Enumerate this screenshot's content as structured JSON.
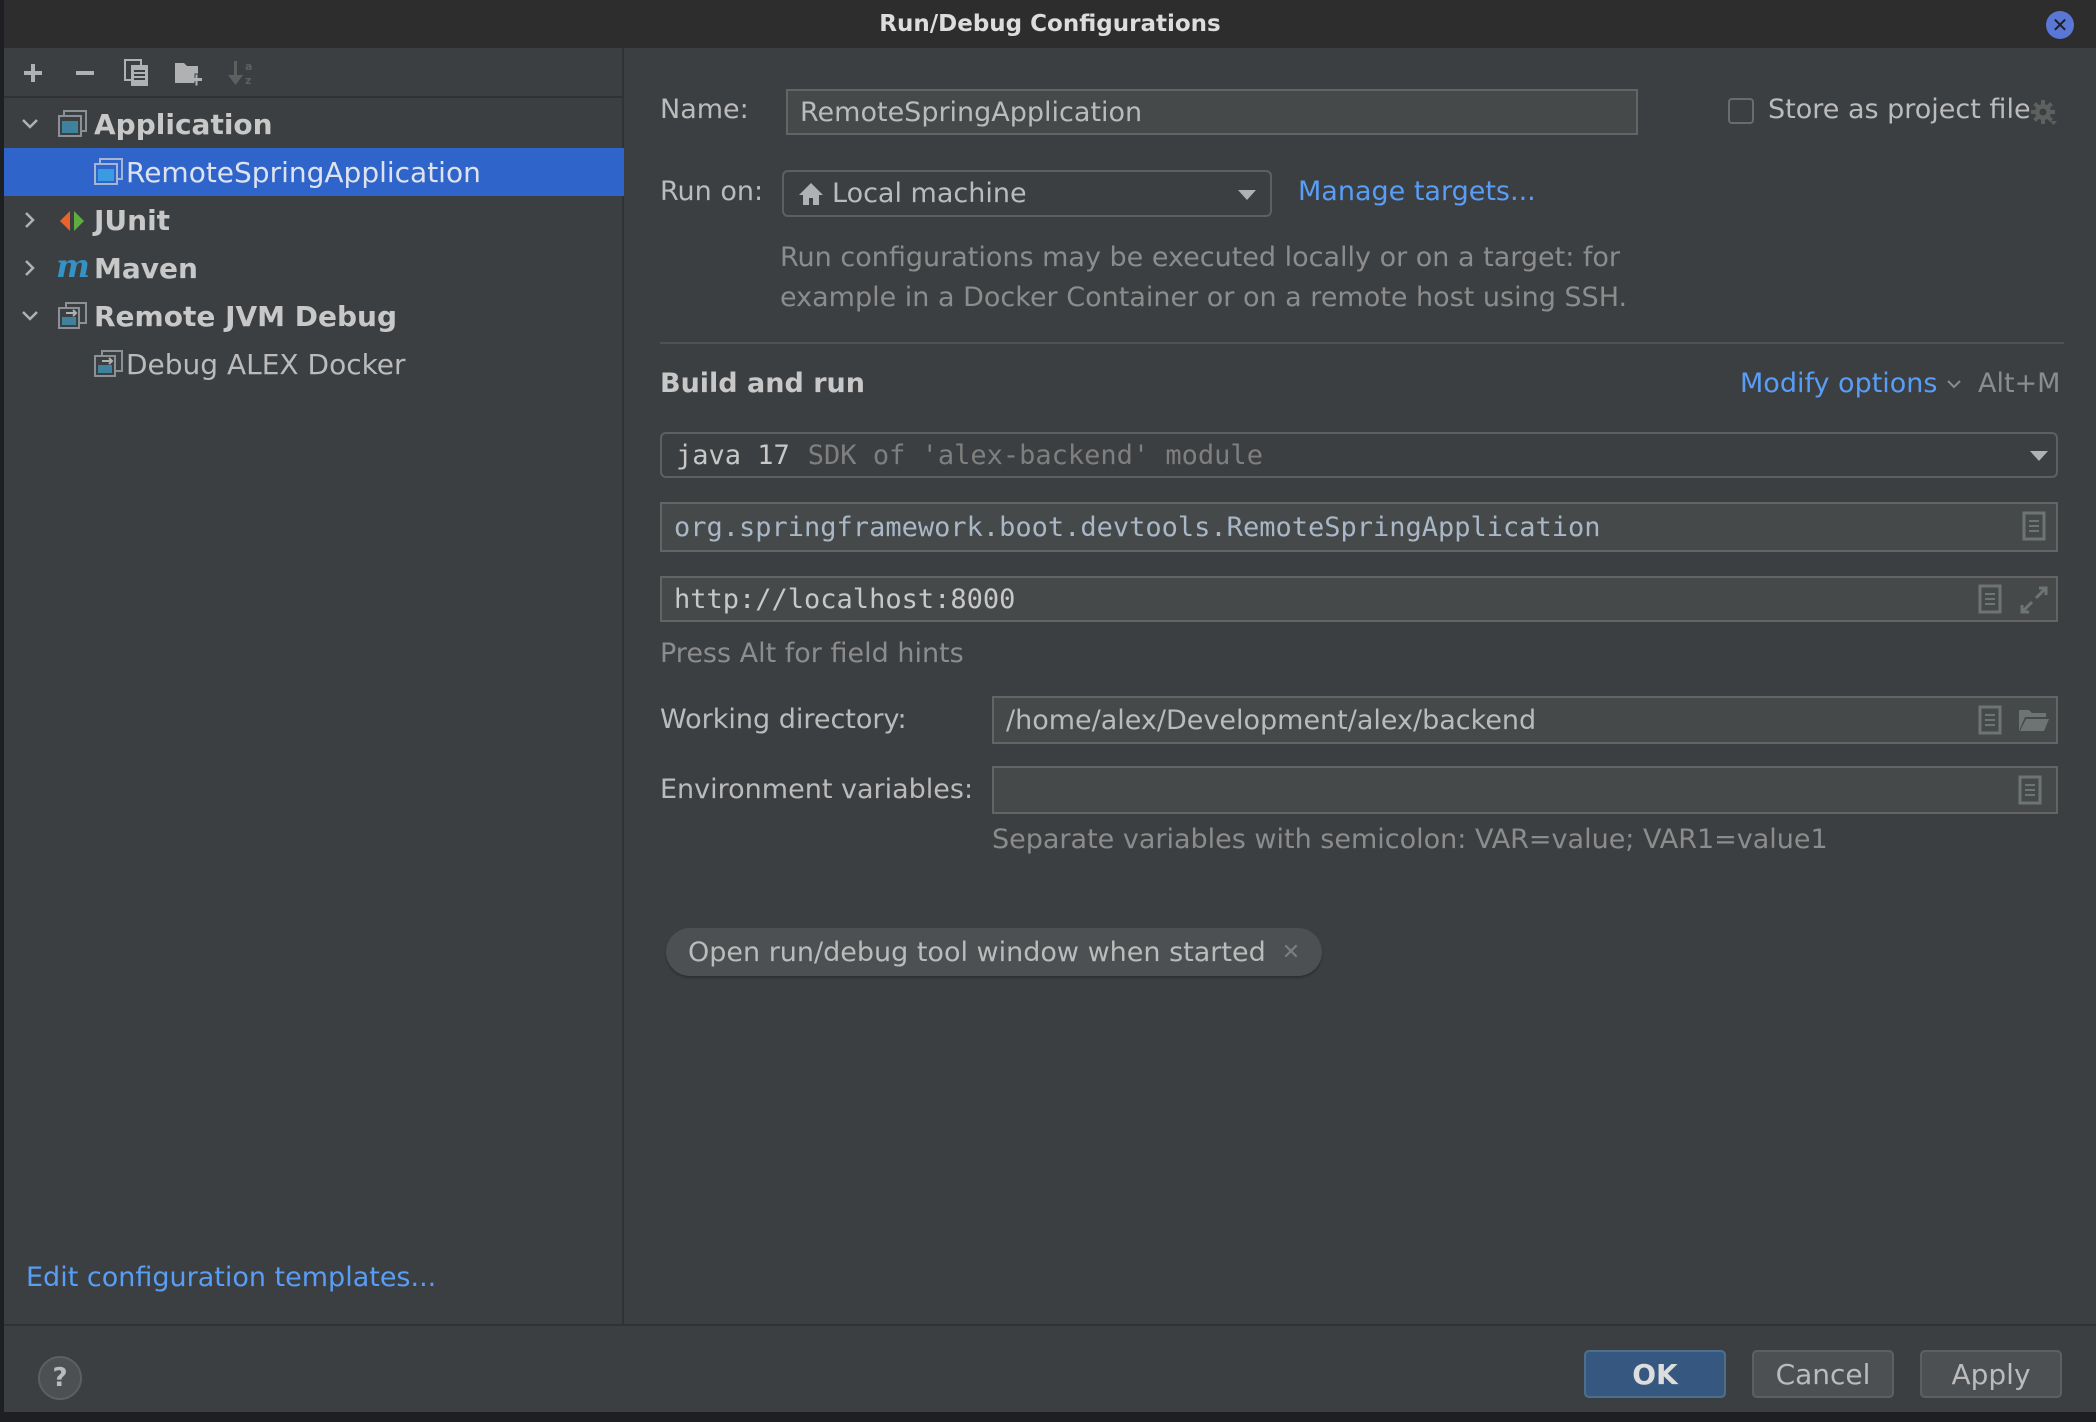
{
  "window": {
    "title": "Run/Debug Configurations"
  },
  "toolbar": {
    "add_icon": "plus-icon",
    "remove_icon": "minus-icon",
    "copy_icon": "copy-icon",
    "new_folder_icon": "new-folder-icon",
    "sort_icon": "sort-alphabetically-icon"
  },
  "tree": {
    "items": [
      {
        "label": "Application",
        "type": "group",
        "expanded": true,
        "icon": "application-icon"
      },
      {
        "label": "RemoteSpringApplication",
        "type": "config",
        "selected": true,
        "icon": "application-icon"
      },
      {
        "label": "JUnit",
        "type": "group",
        "expanded": false,
        "icon": "junit-icon"
      },
      {
        "label": "Maven",
        "type": "group",
        "expanded": false,
        "icon": "maven-icon"
      },
      {
        "label": "Remote JVM Debug",
        "type": "group",
        "expanded": true,
        "icon": "remote-debug-icon"
      },
      {
        "label": "Debug ALEX Docker",
        "type": "config",
        "selected": false,
        "icon": "remote-debug-icon"
      }
    ]
  },
  "left_footer": {
    "edit_templates_link": "Edit configuration templates..."
  },
  "form": {
    "name_label": "Name:",
    "name_value": "RemoteSpringApplication",
    "store_as_project_file_label": "Store as project file",
    "store_as_project_file_checked": false,
    "run_on_label": "Run on:",
    "run_on_value": "Local machine",
    "manage_targets_link": "Manage targets...",
    "run_on_description_line1": "Run configurations may be executed locally or on a target: for",
    "run_on_description_line2": "example in a Docker Container or on a remote host using SSH.",
    "build_and_run_heading": "Build and run",
    "modify_options_link": "Modify options",
    "modify_options_shortcut": "Alt+M",
    "sdk_value": "java 17",
    "sdk_hint": "SDK of 'alex-backend' module",
    "main_class_value": "org.springframework.boot.devtools.RemoteSpringApplication",
    "program_args_value": "http://localhost:8000",
    "field_hints_text": "Press Alt for field hints",
    "working_dir_label": "Working directory:",
    "working_dir_value": "/home/alex/Development/alex/backend",
    "env_vars_label": "Environment variables:",
    "env_vars_value": "",
    "env_vars_hint": "Separate variables with semicolon: VAR=value; VAR1=value1",
    "option_chip_label": "Open run/debug tool window when started"
  },
  "footer": {
    "help_label": "?",
    "ok_label": "OK",
    "cancel_label": "Cancel",
    "apply_label": "Apply"
  },
  "colors": {
    "accent_link": "#589df6",
    "selection": "#2f65ca",
    "primary_button": "#365880",
    "dialog_bg": "#3c3f41",
    "titlebar_bg": "#2d2d2d",
    "close_button": "#5a77d6"
  }
}
